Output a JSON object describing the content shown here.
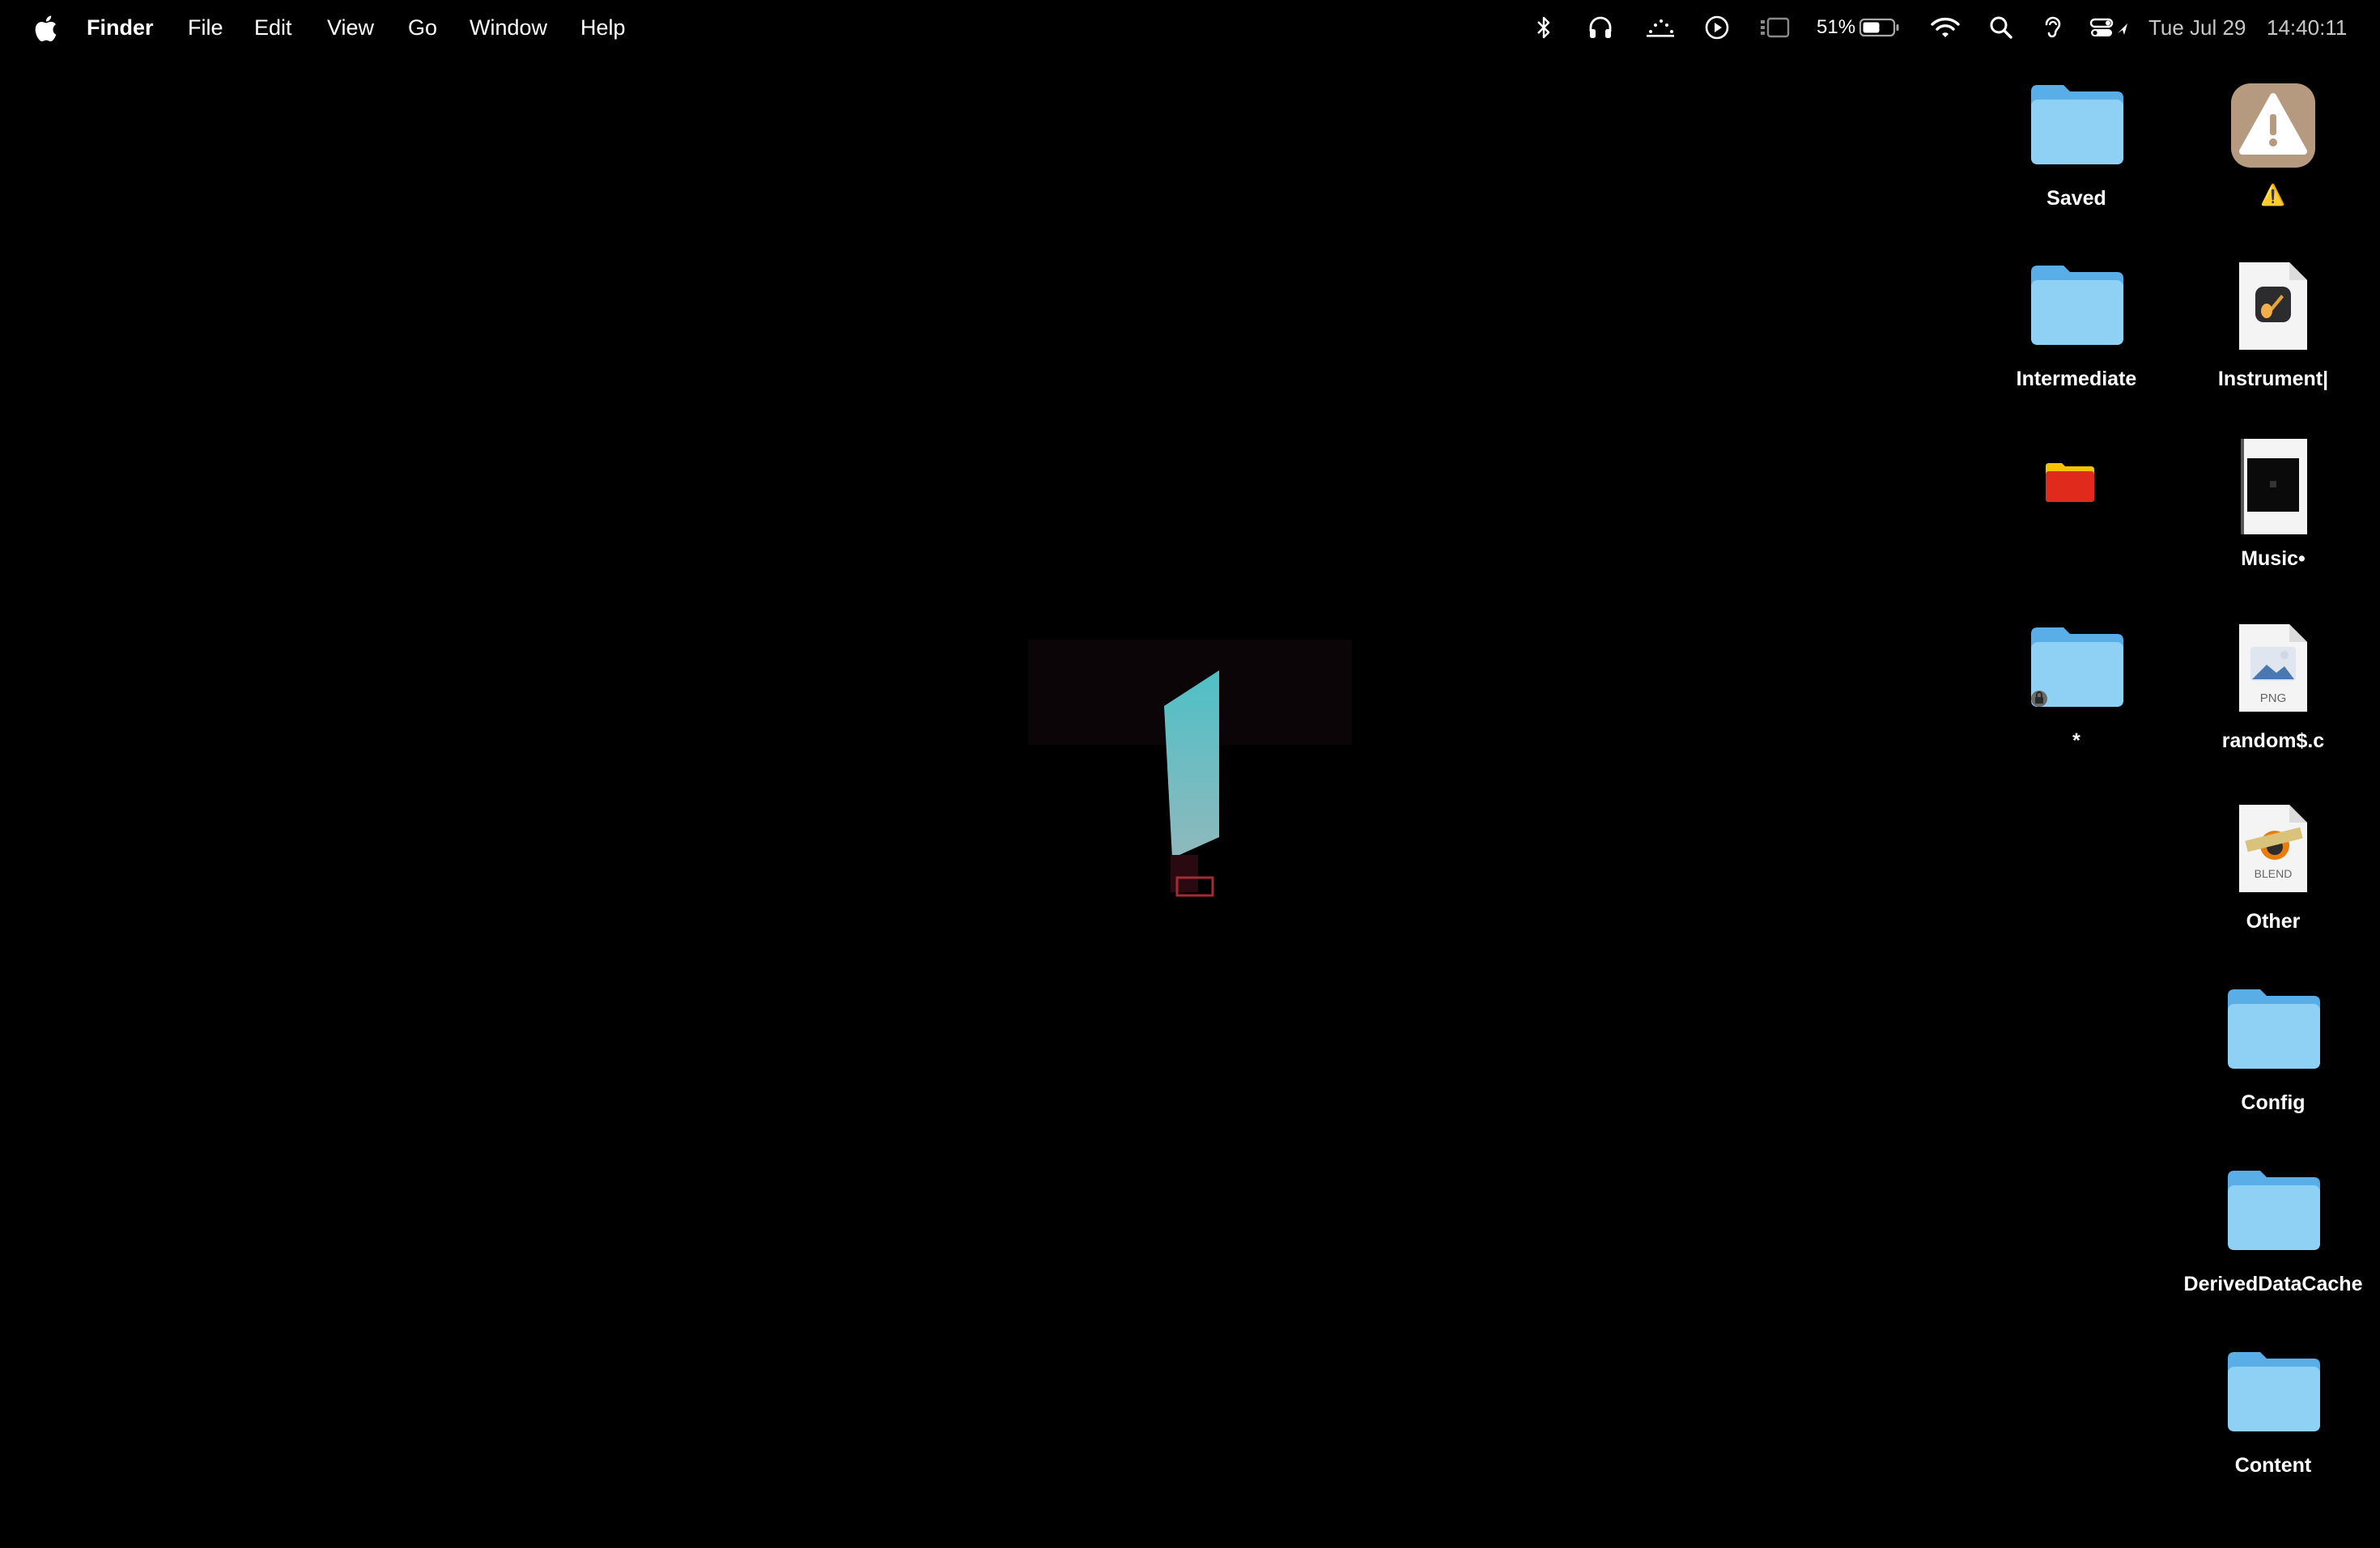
{
  "menubar": {
    "app_name": "Finder",
    "menus": [
      "File",
      "Edit",
      "View",
      "Go",
      "Window",
      "Help"
    ],
    "battery_percent": "51%",
    "date": "Tue Jul 29",
    "time": "14:40:11",
    "status_icons": [
      "bluetooth-icon",
      "headphones-icon",
      "screen-mirror-icon",
      "play-icon",
      "stage-manager-icon",
      "battery-icon",
      "wifi-icon",
      "spotlight-icon",
      "hearing-icon",
      "control-center-icon"
    ]
  },
  "desktop": {
    "icons": [
      {
        "label": "Saved",
        "kind": "folder"
      },
      {
        "label": "⚠️",
        "kind": "warning-app"
      },
      {
        "label": "Intermediate",
        "kind": "folder"
      },
      {
        "label": "Instrument|",
        "kind": "garageband-doc"
      },
      {
        "label": "",
        "kind": "red-folder"
      },
      {
        "label": "Music•",
        "kind": "dark-doc"
      },
      {
        "label": "*",
        "kind": "locked-folder"
      },
      {
        "label": "random$.c",
        "kind": "png-doc"
      },
      {
        "label": "Other",
        "kind": "blend-doc"
      },
      {
        "label": "Config",
        "kind": "folder"
      },
      {
        "label": "DerivedDataCache",
        "kind": "folder"
      },
      {
        "label": "Content",
        "kind": "folder"
      }
    ],
    "png_badge": "PNG",
    "blend_badge": "BLEND"
  },
  "colors": {
    "folder_light": "#8fd0f5",
    "folder_dark": "#5aaee8",
    "red_folder": "#e02a1b",
    "warning_bg": "#b59a7f"
  }
}
